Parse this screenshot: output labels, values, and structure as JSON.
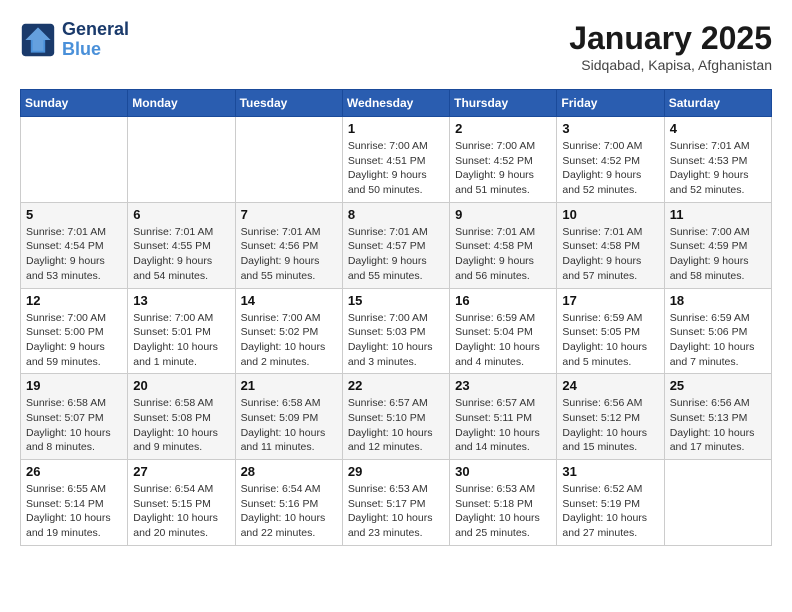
{
  "header": {
    "logo_line1": "General",
    "logo_line2": "Blue",
    "month_title": "January 2025",
    "location": "Sidqabad, Kapisa, Afghanistan"
  },
  "weekdays": [
    "Sunday",
    "Monday",
    "Tuesday",
    "Wednesday",
    "Thursday",
    "Friday",
    "Saturday"
  ],
  "weeks": [
    [
      {
        "day": "",
        "sunrise": "",
        "sunset": "",
        "daylight": ""
      },
      {
        "day": "",
        "sunrise": "",
        "sunset": "",
        "daylight": ""
      },
      {
        "day": "",
        "sunrise": "",
        "sunset": "",
        "daylight": ""
      },
      {
        "day": "1",
        "sunrise": "Sunrise: 7:00 AM",
        "sunset": "Sunset: 4:51 PM",
        "daylight": "Daylight: 9 hours and 50 minutes."
      },
      {
        "day": "2",
        "sunrise": "Sunrise: 7:00 AM",
        "sunset": "Sunset: 4:52 PM",
        "daylight": "Daylight: 9 hours and 51 minutes."
      },
      {
        "day": "3",
        "sunrise": "Sunrise: 7:00 AM",
        "sunset": "Sunset: 4:52 PM",
        "daylight": "Daylight: 9 hours and 52 minutes."
      },
      {
        "day": "4",
        "sunrise": "Sunrise: 7:01 AM",
        "sunset": "Sunset: 4:53 PM",
        "daylight": "Daylight: 9 hours and 52 minutes."
      }
    ],
    [
      {
        "day": "5",
        "sunrise": "Sunrise: 7:01 AM",
        "sunset": "Sunset: 4:54 PM",
        "daylight": "Daylight: 9 hours and 53 minutes."
      },
      {
        "day": "6",
        "sunrise": "Sunrise: 7:01 AM",
        "sunset": "Sunset: 4:55 PM",
        "daylight": "Daylight: 9 hours and 54 minutes."
      },
      {
        "day": "7",
        "sunrise": "Sunrise: 7:01 AM",
        "sunset": "Sunset: 4:56 PM",
        "daylight": "Daylight: 9 hours and 55 minutes."
      },
      {
        "day": "8",
        "sunrise": "Sunrise: 7:01 AM",
        "sunset": "Sunset: 4:57 PM",
        "daylight": "Daylight: 9 hours and 55 minutes."
      },
      {
        "day": "9",
        "sunrise": "Sunrise: 7:01 AM",
        "sunset": "Sunset: 4:58 PM",
        "daylight": "Daylight: 9 hours and 56 minutes."
      },
      {
        "day": "10",
        "sunrise": "Sunrise: 7:01 AM",
        "sunset": "Sunset: 4:58 PM",
        "daylight": "Daylight: 9 hours and 57 minutes."
      },
      {
        "day": "11",
        "sunrise": "Sunrise: 7:00 AM",
        "sunset": "Sunset: 4:59 PM",
        "daylight": "Daylight: 9 hours and 58 minutes."
      }
    ],
    [
      {
        "day": "12",
        "sunrise": "Sunrise: 7:00 AM",
        "sunset": "Sunset: 5:00 PM",
        "daylight": "Daylight: 9 hours and 59 minutes."
      },
      {
        "day": "13",
        "sunrise": "Sunrise: 7:00 AM",
        "sunset": "Sunset: 5:01 PM",
        "daylight": "Daylight: 10 hours and 1 minute."
      },
      {
        "day": "14",
        "sunrise": "Sunrise: 7:00 AM",
        "sunset": "Sunset: 5:02 PM",
        "daylight": "Daylight: 10 hours and 2 minutes."
      },
      {
        "day": "15",
        "sunrise": "Sunrise: 7:00 AM",
        "sunset": "Sunset: 5:03 PM",
        "daylight": "Daylight: 10 hours and 3 minutes."
      },
      {
        "day": "16",
        "sunrise": "Sunrise: 6:59 AM",
        "sunset": "Sunset: 5:04 PM",
        "daylight": "Daylight: 10 hours and 4 minutes."
      },
      {
        "day": "17",
        "sunrise": "Sunrise: 6:59 AM",
        "sunset": "Sunset: 5:05 PM",
        "daylight": "Daylight: 10 hours and 5 minutes."
      },
      {
        "day": "18",
        "sunrise": "Sunrise: 6:59 AM",
        "sunset": "Sunset: 5:06 PM",
        "daylight": "Daylight: 10 hours and 7 minutes."
      }
    ],
    [
      {
        "day": "19",
        "sunrise": "Sunrise: 6:58 AM",
        "sunset": "Sunset: 5:07 PM",
        "daylight": "Daylight: 10 hours and 8 minutes."
      },
      {
        "day": "20",
        "sunrise": "Sunrise: 6:58 AM",
        "sunset": "Sunset: 5:08 PM",
        "daylight": "Daylight: 10 hours and 9 minutes."
      },
      {
        "day": "21",
        "sunrise": "Sunrise: 6:58 AM",
        "sunset": "Sunset: 5:09 PM",
        "daylight": "Daylight: 10 hours and 11 minutes."
      },
      {
        "day": "22",
        "sunrise": "Sunrise: 6:57 AM",
        "sunset": "Sunset: 5:10 PM",
        "daylight": "Daylight: 10 hours and 12 minutes."
      },
      {
        "day": "23",
        "sunrise": "Sunrise: 6:57 AM",
        "sunset": "Sunset: 5:11 PM",
        "daylight": "Daylight: 10 hours and 14 minutes."
      },
      {
        "day": "24",
        "sunrise": "Sunrise: 6:56 AM",
        "sunset": "Sunset: 5:12 PM",
        "daylight": "Daylight: 10 hours and 15 minutes."
      },
      {
        "day": "25",
        "sunrise": "Sunrise: 6:56 AM",
        "sunset": "Sunset: 5:13 PM",
        "daylight": "Daylight: 10 hours and 17 minutes."
      }
    ],
    [
      {
        "day": "26",
        "sunrise": "Sunrise: 6:55 AM",
        "sunset": "Sunset: 5:14 PM",
        "daylight": "Daylight: 10 hours and 19 minutes."
      },
      {
        "day": "27",
        "sunrise": "Sunrise: 6:54 AM",
        "sunset": "Sunset: 5:15 PM",
        "daylight": "Daylight: 10 hours and 20 minutes."
      },
      {
        "day": "28",
        "sunrise": "Sunrise: 6:54 AM",
        "sunset": "Sunset: 5:16 PM",
        "daylight": "Daylight: 10 hours and 22 minutes."
      },
      {
        "day": "29",
        "sunrise": "Sunrise: 6:53 AM",
        "sunset": "Sunset: 5:17 PM",
        "daylight": "Daylight: 10 hours and 23 minutes."
      },
      {
        "day": "30",
        "sunrise": "Sunrise: 6:53 AM",
        "sunset": "Sunset: 5:18 PM",
        "daylight": "Daylight: 10 hours and 25 minutes."
      },
      {
        "day": "31",
        "sunrise": "Sunrise: 6:52 AM",
        "sunset": "Sunset: 5:19 PM",
        "daylight": "Daylight: 10 hours and 27 minutes."
      },
      {
        "day": "",
        "sunrise": "",
        "sunset": "",
        "daylight": ""
      }
    ]
  ]
}
